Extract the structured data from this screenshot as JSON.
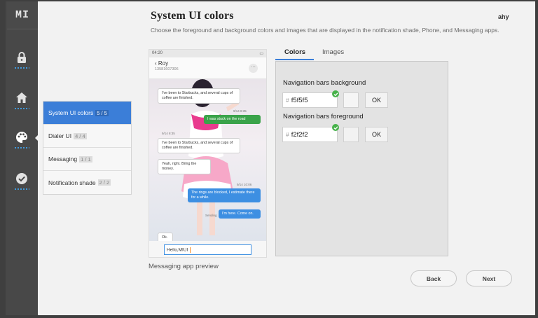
{
  "brand": {
    "logo": "MI"
  },
  "sidebar": {
    "icons": [
      "lock-icon",
      "home-icon",
      "palette-icon",
      "check-circle-icon"
    ],
    "accent": "#3fa0e8"
  },
  "header": {
    "title": "System UI colors",
    "subtitle": "Choose the foreground and background colors and images that are displayed in the notification shade, Phone, and Messaging apps.",
    "user": "ahy"
  },
  "steps": [
    {
      "label": "System UI colors",
      "count": "5 / 5",
      "active": true
    },
    {
      "label": "Dialer UI",
      "count": "4 / 4",
      "active": false
    },
    {
      "label": "Messaging",
      "count": "1 / 1",
      "active": false
    },
    {
      "label": "Notification shade",
      "count": "2 / 2",
      "active": false
    }
  ],
  "preview": {
    "status_time": "04:20",
    "contact_name": "Roy",
    "contact_number": "13581607306",
    "messages": [
      {
        "dir": "in",
        "text": "I've been to Starbucks, and several cups of coffee are finished."
      },
      {
        "dir": "out",
        "text": "I was stuck on the road"
      },
      {
        "dir": "in",
        "text": "I've been to Starbucks, and several cups of coffee are finished."
      },
      {
        "dir": "in",
        "text": "Yeah, right. Bring the money."
      },
      {
        "dir": "blue",
        "text": "The rings are blocked, I estimate there for a while."
      },
      {
        "dir": "blue",
        "text": "I'm here. Come on."
      },
      {
        "dir": "in",
        "text": "Ok."
      }
    ],
    "timestamps": [
      "9/14 8:35",
      "9/14 8:35",
      "9/14 8:35",
      "9/14 10:06",
      "9/14 10:06"
    ],
    "sending_label": "Sending",
    "input_value": "Hello,MIUI",
    "label": "Messaging app preview"
  },
  "tabs": {
    "colors": "Colors",
    "images": "Images"
  },
  "fields": {
    "nav_bg_label": "Navigation bars background",
    "nav_bg_value": "f5f5f5",
    "nav_fg_label": "Navigation bars foreground",
    "nav_fg_value": "f2f2f2",
    "hash": "#",
    "ok": "OK"
  },
  "colors": {
    "nav_bg": "#f5f5f5",
    "nav_fg": "#f2f2f2",
    "check": "#47b24a",
    "active_step": "#3b7ed8"
  },
  "footer": {
    "back": "Back",
    "next": "Next"
  }
}
